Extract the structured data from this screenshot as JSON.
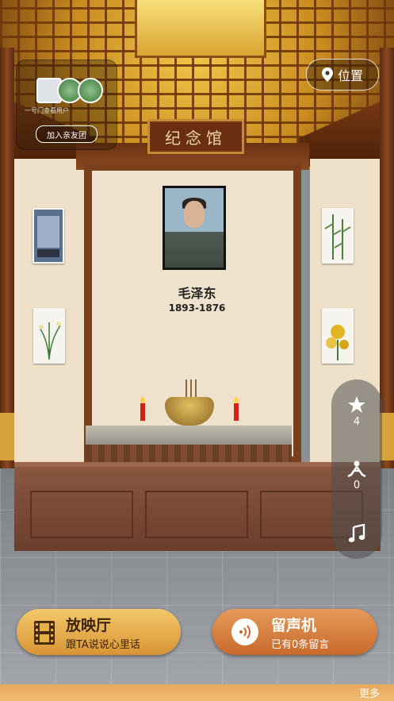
{
  "hall": {
    "plaque": "纪念馆",
    "name": "毛泽东",
    "years": "1893-1876"
  },
  "family": {
    "caption": "一号门查看用户",
    "join_label": "加入亲友团"
  },
  "location": {
    "label": "位置"
  },
  "side_actions": {
    "star_count": "4",
    "offer_count": "0"
  },
  "hall_button": {
    "title": "放映厅",
    "subtitle": "跟TA说说心里话"
  },
  "phono_button": {
    "title": "留声机",
    "subtitle": "已有0条留言"
  },
  "footer": {
    "more": "更多"
  },
  "colors": {
    "gold": "#d89434",
    "wood": "#7a3f1c",
    "wall": "#eee2cd"
  }
}
